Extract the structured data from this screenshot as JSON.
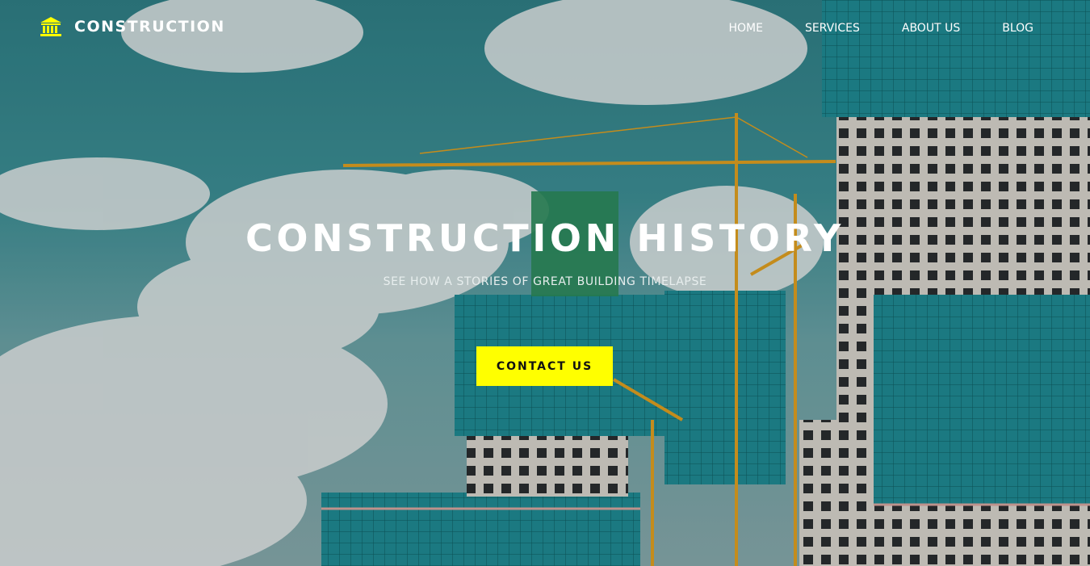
{
  "brand": {
    "name": "CONSTRUCTION",
    "icon": "bank-building-icon",
    "icon_color": "#ffff00"
  },
  "nav": {
    "items": [
      {
        "label": "HOME"
      },
      {
        "label": "SERVICES"
      },
      {
        "label": "ABOUT US"
      },
      {
        "label": "BLOG"
      }
    ]
  },
  "hero": {
    "title": "CONSTRUCTION HISTORY",
    "subtitle": "SEE HOW A STORIES OF GREAT BUILDING TIMELAPSE",
    "cta_label": "CONTACT US",
    "cta_color": "#ffff00"
  }
}
